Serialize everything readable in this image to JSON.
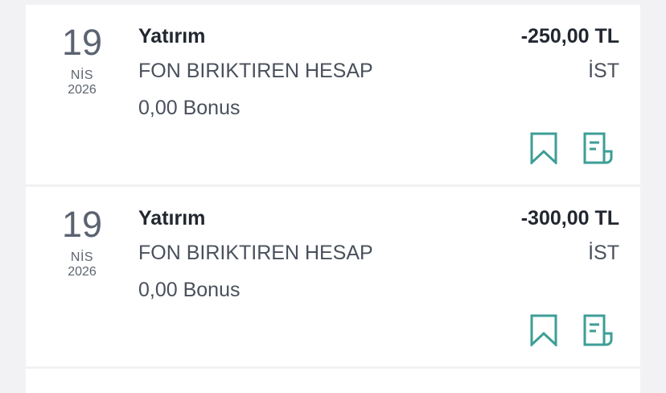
{
  "accent_color": "#3d9e97",
  "transactions": [
    {
      "day": "19",
      "month": "NİS",
      "year": "2026",
      "title": "Yatırım",
      "subtitle": "FON BIRIKTIREN HESAP",
      "bonus": "0,00 Bonus",
      "amount": "-250,00 TL",
      "location": "İST",
      "icons": [
        "bookmark-icon",
        "receipt-icon"
      ]
    },
    {
      "day": "19",
      "month": "NİS",
      "year": "2026",
      "title": "Yatırım",
      "subtitle": "FON BIRIKTIREN HESAP",
      "bonus": "0,00 Bonus",
      "amount": "-300,00 TL",
      "location": "İST",
      "icons": [
        "bookmark-icon",
        "receipt-icon"
      ]
    }
  ]
}
